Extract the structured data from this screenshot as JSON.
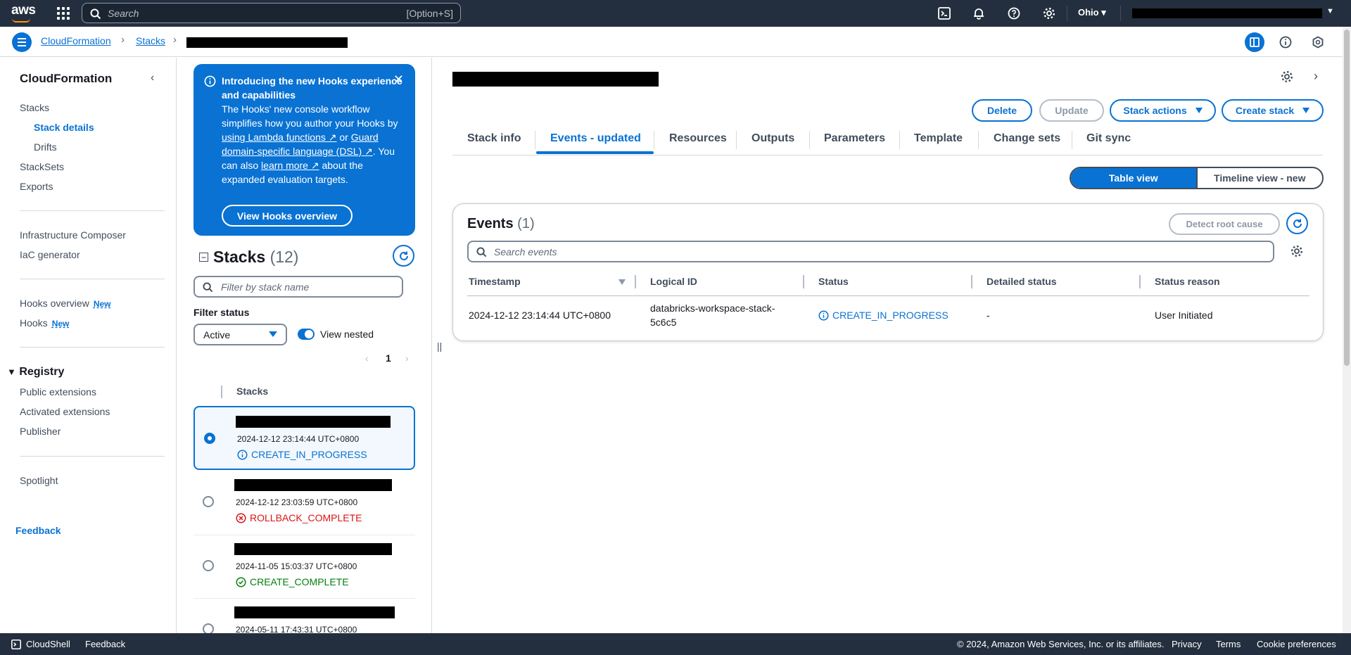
{
  "topnav": {
    "logo": "aws",
    "search_placeholder": "Search",
    "search_shortcut": "[Option+S]",
    "region": "Ohio"
  },
  "breadcrumb": {
    "items": [
      "CloudFormation",
      "Stacks"
    ]
  },
  "leftnav": {
    "title": "CloudFormation",
    "items": {
      "stacks": "Stacks",
      "stack_details": "Stack details",
      "drifts": "Drifts",
      "stacksets": "StackSets",
      "exports": "Exports",
      "infra_composer": "Infrastructure Composer",
      "iac_generator": "IaC generator",
      "hooks_overview": "Hooks overview",
      "hooks": "Hooks",
      "new_badge": "New",
      "registry": "Registry",
      "public_ext": "Public extensions",
      "activated_ext": "Activated extensions",
      "publisher": "Publisher",
      "spotlight": "Spotlight",
      "feedback": "Feedback"
    }
  },
  "hooks_flash": {
    "title": "Introducing the new Hooks experience and capabilities",
    "body_1": "The Hooks' new console workflow simplifies how you author your Hooks by ",
    "link_1": "using Lambda functions",
    "body_2": " or ",
    "link_2": "Guard domain-specific language (DSL)",
    "body_3": ". You can also ",
    "link_3": "learn more",
    "body_4": " about the expanded evaluation targets.",
    "button": "View Hooks overview"
  },
  "stacks_panel": {
    "title": "Stacks",
    "count": "(12)",
    "filter_placeholder": "Filter by stack name",
    "filter_status_label": "Filter status",
    "filter_status_value": "Active",
    "view_nested_label": "View nested",
    "page": "1",
    "column_header": "Stacks",
    "rows": [
      {
        "date": "2024-12-12 23:14:44 UTC+0800",
        "status": "CREATE_IN_PROGRESS",
        "status_color": "#0972d3"
      },
      {
        "date": "2024-12-12 23:03:59 UTC+0800",
        "status": "ROLLBACK_COMPLETE",
        "status_color": "#d91515"
      },
      {
        "date": "2024-11-05 15:03:37 UTC+0800",
        "status": "CREATE_COMPLETE",
        "status_color": "#037f0c"
      },
      {
        "date": "2024-05-11 17:43:31 UTC+0800",
        "status": "",
        "status_color": "#414d5c"
      }
    ]
  },
  "actions": {
    "delete": "Delete",
    "update": "Update",
    "stack_actions": "Stack actions",
    "create_stack": "Create stack"
  },
  "tabs": [
    "Stack info",
    "Events - updated",
    "Resources",
    "Outputs",
    "Parameters",
    "Template",
    "Change sets",
    "Git sync"
  ],
  "view_toggle": {
    "table": "Table view",
    "timeline": "Timeline view - new"
  },
  "events": {
    "title": "Events",
    "count": "(1)",
    "detect_root_cause": "Detect root cause",
    "search_placeholder": "Search events",
    "columns": [
      "Timestamp",
      "Logical ID",
      "Status",
      "Detailed status",
      "Status reason"
    ],
    "rows": [
      {
        "timestamp": "2024-12-12 23:14:44 UTC+0800",
        "logical_id_1": "databricks-workspace-stack-",
        "logical_id_2": "5c6c5",
        "status": "CREATE_IN_PROGRESS",
        "detailed_status": "-",
        "status_reason": "User Initiated"
      }
    ]
  },
  "footer": {
    "cloudshell": "CloudShell",
    "feedback": "Feedback",
    "copyright": "© 2024, Amazon Web Services, Inc. or its affiliates.",
    "privacy": "Privacy",
    "terms": "Terms",
    "cookies": "Cookie preferences"
  },
  "colors": {
    "nav_bg": "#232f3e",
    "accent": "#0972d3",
    "error": "#d91515",
    "success": "#037f0c"
  }
}
